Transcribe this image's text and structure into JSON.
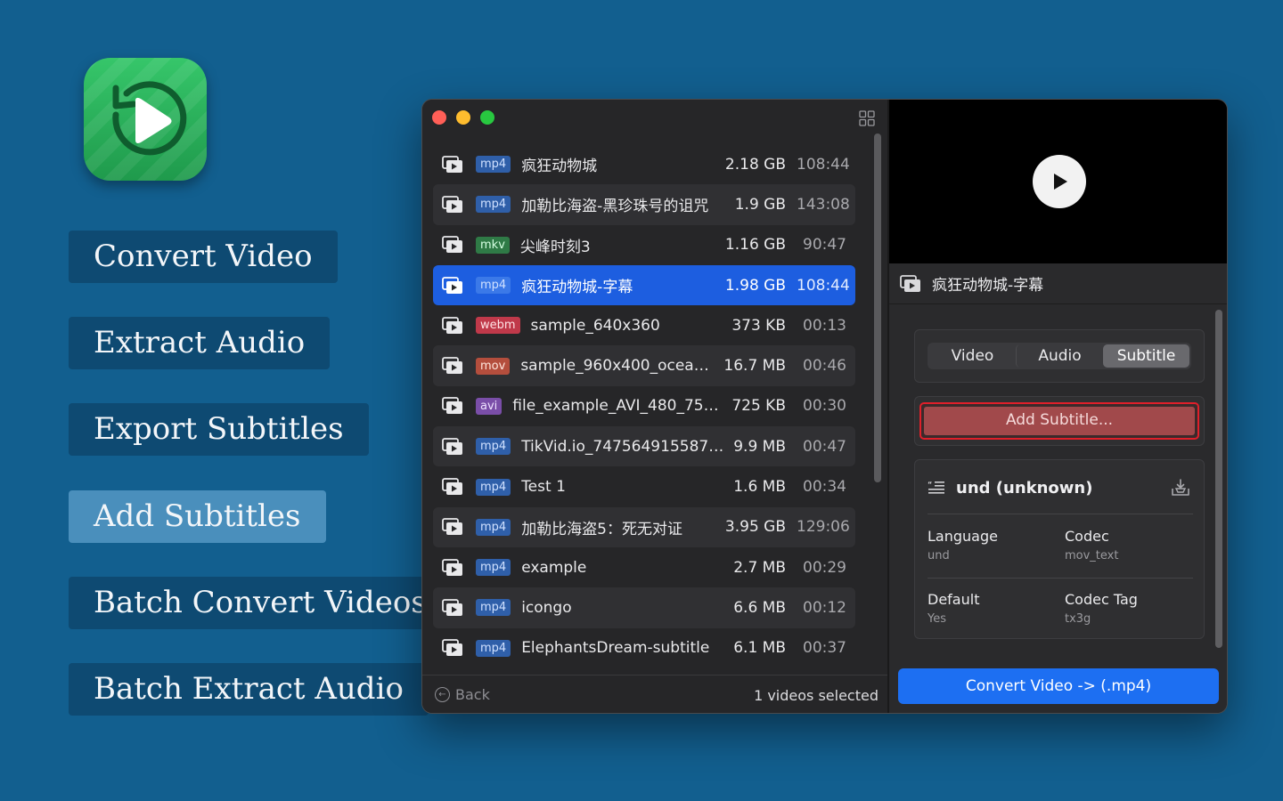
{
  "features": [
    {
      "label": "Convert Video",
      "active": false
    },
    {
      "label": "Extract Audio",
      "active": false
    },
    {
      "label": "Export Subtitles",
      "active": false
    },
    {
      "label": "Add Subtitles",
      "active": true
    },
    {
      "label": "Batch Convert Videos",
      "active": false
    },
    {
      "label": "Batch Extract Audio",
      "active": false
    }
  ],
  "files": [
    {
      "format": "mp4",
      "name": "疯狂动物城",
      "size": "2.18 GB",
      "duration": "108:44"
    },
    {
      "format": "mp4",
      "name": "加勒比海盗-黑珍珠号的诅咒",
      "size": "1.9 GB",
      "duration": "143:08"
    },
    {
      "format": "mkv",
      "name": "尖峰时刻3",
      "size": "1.16 GB",
      "duration": "90:47"
    },
    {
      "format": "mp4",
      "name": "疯狂动物城-字幕",
      "size": "1.98 GB",
      "duration": "108:44",
      "selected": true
    },
    {
      "format": "webm",
      "name": "sample_640x360",
      "size": "373 KB",
      "duration": "00:13"
    },
    {
      "format": "mov",
      "name": "sample_960x400_ocean...",
      "size": "16.7 MB",
      "duration": "00:46"
    },
    {
      "format": "avi",
      "name": "file_example_AVI_480_750...",
      "size": "725 KB",
      "duration": "00:30"
    },
    {
      "format": "mp4",
      "name": "TikVid.io_7475649155877...",
      "size": "9.9 MB",
      "duration": "00:47"
    },
    {
      "format": "mp4",
      "name": "Test 1",
      "size": "1.6 MB",
      "duration": "00:34"
    },
    {
      "format": "mp4",
      "name": "加勒比海盗5：死无对证",
      "size": "3.95 GB",
      "duration": "129:06"
    },
    {
      "format": "mp4",
      "name": "example",
      "size": "2.7 MB",
      "duration": "00:29"
    },
    {
      "format": "mp4",
      "name": "icongo",
      "size": "6.6 MB",
      "duration": "00:12"
    },
    {
      "format": "mp4",
      "name": "ElephantsDream-subtitle",
      "size": "6.1 MB",
      "duration": "00:37"
    }
  ],
  "footer": {
    "back_label": "Back",
    "selection_text": "1 videos selected"
  },
  "detail": {
    "title": "疯狂动物城-字幕",
    "tabs": [
      {
        "label": "Video",
        "active": false
      },
      {
        "label": "Audio",
        "active": false
      },
      {
        "label": "Subtitle",
        "active": true
      }
    ],
    "add_subtitle_label": "Add Subtitle...",
    "track": {
      "name": "und (unknown)",
      "fields": [
        {
          "key": "Language",
          "value": "und"
        },
        {
          "key": "Codec",
          "value": "mov_text"
        },
        {
          "key": "Default",
          "value": "Yes"
        },
        {
          "key": "Codec Tag",
          "value": "tx3g"
        }
      ]
    },
    "convert_label": "Convert Video -> (.mp4)"
  },
  "colors": {
    "background": "#125f8f",
    "selection": "#1d5ee0",
    "convert_button": "#1d6ff2",
    "add_subtitle_highlight": "#e01f2a"
  }
}
